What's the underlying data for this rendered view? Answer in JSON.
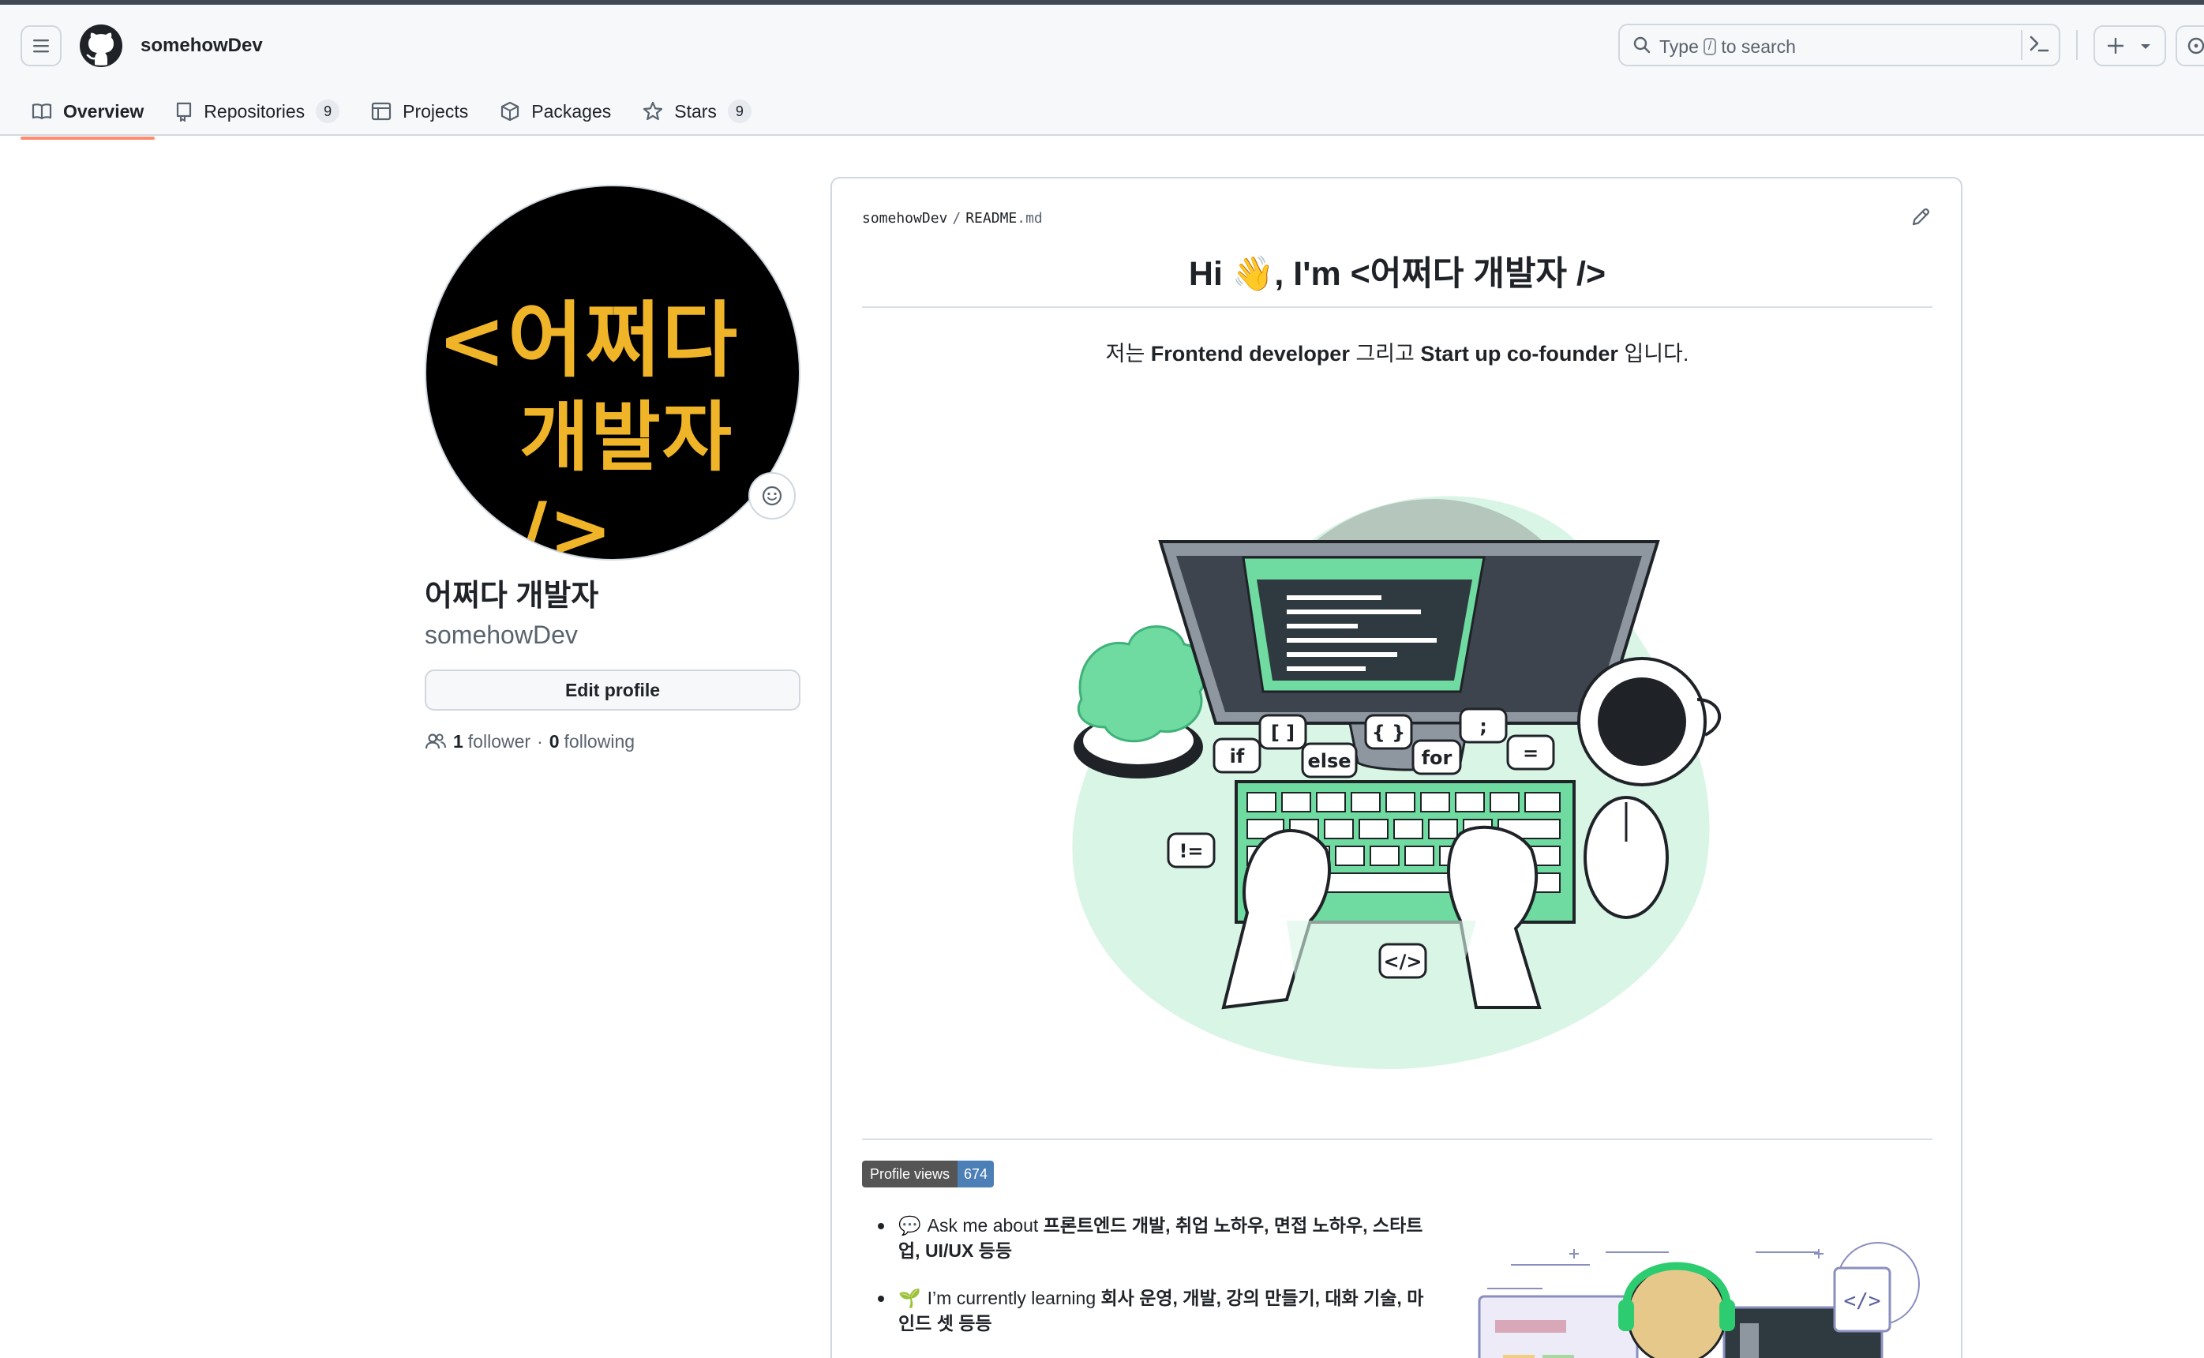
{
  "header": {
    "owner": "somehowDev",
    "search_prefix": "Type",
    "search_key": "/",
    "search_suffix": "to search"
  },
  "tabs": [
    {
      "label": "Overview",
      "active": true
    },
    {
      "label": "Repositories",
      "count": "9"
    },
    {
      "label": "Projects"
    },
    {
      "label": "Packages"
    },
    {
      "label": "Stars",
      "count": "9"
    }
  ],
  "profile": {
    "avatar_text_line1": "<어쩌다",
    "avatar_text_line2": "개발자 />",
    "display_name": "어쩌다 개발자",
    "username": "somehowDev",
    "edit_label": "Edit profile",
    "followers": "1",
    "followers_label": "follower",
    "separator": "·",
    "following": "0",
    "following_label": "following"
  },
  "readme": {
    "crumb_owner": "somehowDev",
    "crumb_sep": "/",
    "crumb_file": "README",
    "crumb_ext": ".md",
    "heading": "Hi 👋, I'm <어쩌다 개발자 />",
    "intro_pre": "저는 ",
    "intro_b1": "Frontend developer",
    "intro_mid": " 그리고 ",
    "intro_b2": "Start up co-founder",
    "intro_post": " 입니다.",
    "badge_label": "Profile views",
    "badge_value": "674",
    "bullets": [
      {
        "icon": "💬",
        "text": "Ask me about ",
        "bold": "프론트엔드 개발, 취업 노하우, 면접 노하우, 스타트 업, UI/UX 등등"
      },
      {
        "icon": "🌱",
        "text": "I’m currently learning ",
        "bold": "회사 운영, 개발, 강의 만들기, 대화 기술, 마인드 셋 등등"
      }
    ],
    "keyboard_bubbles": [
      "if",
      "[ ]",
      "else",
      "{ }",
      "for",
      ";",
      "=",
      "!=",
      "</>"
    ]
  },
  "colors": {
    "tab_underline": "#fd8c73",
    "avatar_text": "#f0b429",
    "badge_left": "#555555",
    "badge_right": "#4c7fb6",
    "illustration_green": "#6fdba0"
  }
}
